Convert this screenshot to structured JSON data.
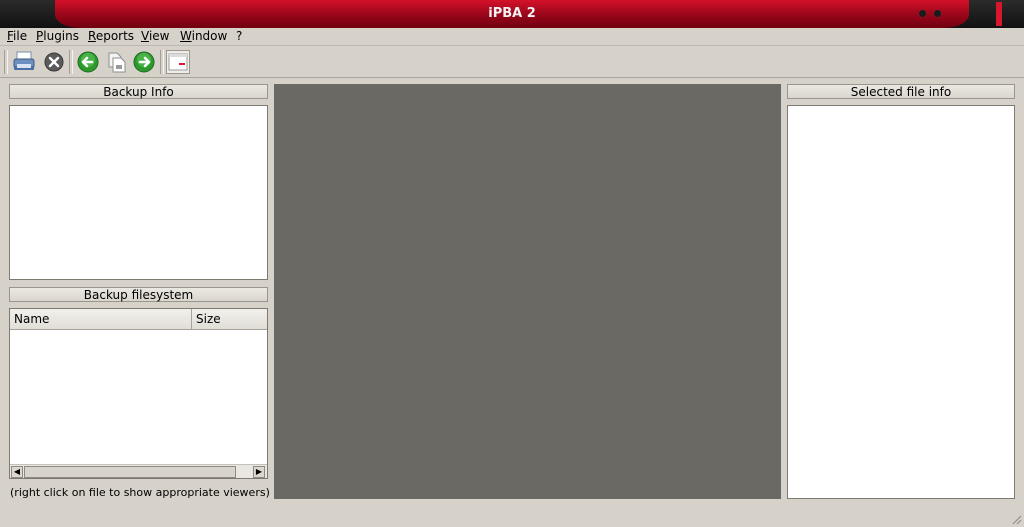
{
  "window": {
    "title": "iPBA 2"
  },
  "menubar": {
    "items": [
      {
        "label": "File",
        "mnemonic": "F"
      },
      {
        "label": "Plugins",
        "mnemonic": "P"
      },
      {
        "label": "Reports",
        "mnemonic": "R"
      },
      {
        "label": "View",
        "mnemonic": "V"
      },
      {
        "label": "Window",
        "mnemonic": "W"
      },
      {
        "label": "?",
        "mnemonic": ""
      }
    ]
  },
  "toolbar": {
    "buttons": [
      {
        "icon": "printer-icon"
      },
      {
        "icon": "close-circle-icon"
      },
      {
        "icon": "arrow-left-icon"
      },
      {
        "icon": "document-icon"
      },
      {
        "icon": "arrow-right-icon"
      },
      {
        "icon": "window-panel-icon",
        "checked": true
      }
    ]
  },
  "backup_info": {
    "header": "Backup Info"
  },
  "backup_filesystem": {
    "header": "Backup filesystem",
    "columns": [
      "Name",
      "Size"
    ],
    "rows": [],
    "hint": "(right click on file to show appropriate viewers)"
  },
  "selected_file_info": {
    "header": "Selected file info"
  },
  "colors": {
    "titlebar_accent": "#b00d22",
    "window_bg": "#d6d2c9",
    "center_area": "#6a6963"
  }
}
